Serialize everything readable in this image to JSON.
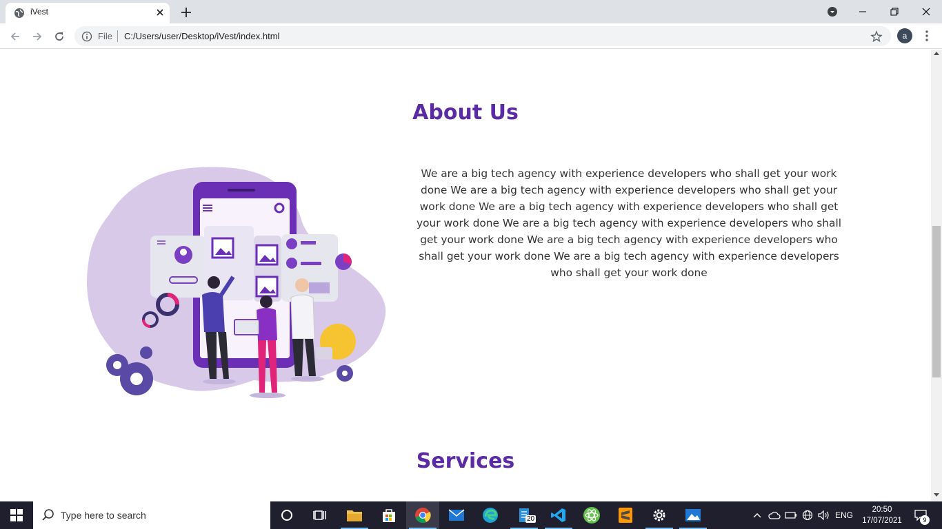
{
  "browser": {
    "tab_title": "iVest",
    "omnibox_scheme": "File",
    "url": "C:/Users/user/Desktop/iVest/index.html",
    "profile_initial": "a"
  },
  "page": {
    "about_title": "About Us",
    "about_text": "We are a big tech agency with experience developers who shall get your work done We are a big tech agency with experience developers who shall get your work done We are a big tech agency with experience developers who shall get your work done We are a big tech agency with experience developers who shall get your work done We are a big tech agency with experience developers who shall get your work done We are a big tech agency with experience developers who shall get your work done",
    "services_title": "Services",
    "accent_color": "#5b2aa5"
  },
  "taskbar": {
    "search_placeholder": "Type here to search",
    "mail_badge": "20",
    "language": "ENG",
    "time": "20:50",
    "date": "17/07/2021",
    "notifications": "9"
  }
}
